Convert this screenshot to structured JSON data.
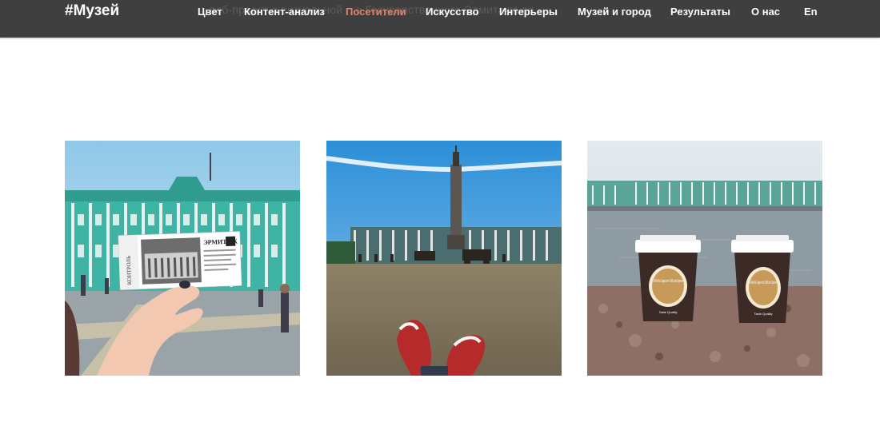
{
  "header": {
    "logo": "#Музей",
    "background_text": "веб-проект о визуальной ...е Государственного Эрмитажа ве",
    "nav": [
      {
        "label": "Цвет",
        "active": false
      },
      {
        "label": "Контент-анализ",
        "active": false
      },
      {
        "label": "Посетители",
        "active": true
      },
      {
        "label": "Искусство",
        "active": false
      },
      {
        "label": "Интерьеры",
        "active": false
      },
      {
        "label": "Музей и город",
        "active": false
      },
      {
        "label": "Результаты",
        "active": false
      },
      {
        "label": "О нас",
        "active": false
      },
      {
        "label": "En",
        "active": false
      }
    ]
  },
  "photos": {
    "ticket": {
      "side_text": "КОНТРОЛЬ",
      "brand": "ЭРМИТАЖ"
    },
    "cups": {
      "cup_text": "CoffeeTea Cappuccino CaffeLatte Espresso",
      "cup_brand": "Taste Quality"
    }
  },
  "colors": {
    "navbar": "#3f3f3f",
    "nav_text": "#ffffff",
    "nav_active": "#e0836b"
  }
}
